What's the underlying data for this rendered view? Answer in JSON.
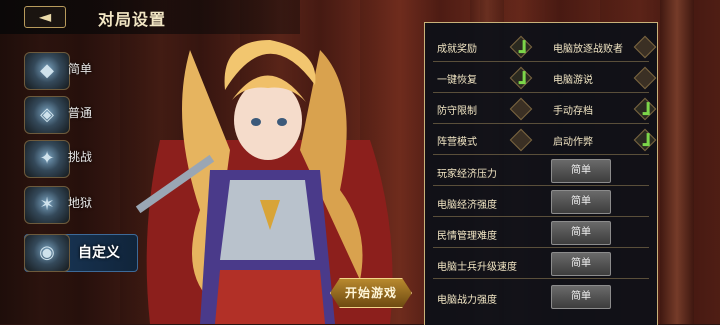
{
  "header": {
    "title": "对局设置",
    "back_icon": "back-arrow-icon"
  },
  "difficulties": [
    {
      "label": "简单",
      "icon": "shield-emblem-icon",
      "glyph": "◆"
    },
    {
      "label": "普通",
      "icon": "helmet-emblem-icon",
      "glyph": "◈"
    },
    {
      "label": "挑战",
      "icon": "crest-emblem-icon",
      "glyph": "✦"
    },
    {
      "label": "地狱",
      "icon": "star-emblem-icon",
      "glyph": "✶"
    },
    {
      "label": "自定义",
      "icon": "custom-emblem-icon",
      "glyph": "◉",
      "active": true
    }
  ],
  "toggles": [
    {
      "left": {
        "label": "成就奖励",
        "checked": true
      },
      "right": {
        "label": "电脑放逐战败者",
        "checked": false
      }
    },
    {
      "left": {
        "label": "一键恢复",
        "checked": true
      },
      "right": {
        "label": "电脑游说",
        "checked": false
      }
    },
    {
      "left": {
        "label": "防守限制",
        "checked": false
      },
      "right": {
        "label": "手动存档",
        "checked": true
      }
    },
    {
      "left": {
        "label": "阵营模式",
        "checked": false
      },
      "right": {
        "label": "启动作弊",
        "checked": true
      }
    }
  ],
  "selects": [
    {
      "label": "玩家经济压力",
      "value": "简单"
    },
    {
      "label": "电脑经济强度",
      "value": "简单"
    },
    {
      "label": "民情管理难度",
      "value": "简单"
    },
    {
      "label": "电脑士兵升级速度",
      "value": "简单"
    },
    {
      "label": "电脑战力强度",
      "value": "简单"
    }
  ],
  "start_button": "开始游戏",
  "colors": {
    "panel_border": "#c9b27a",
    "check": "#7cd64a",
    "active_tab": "#1b3a5c"
  }
}
